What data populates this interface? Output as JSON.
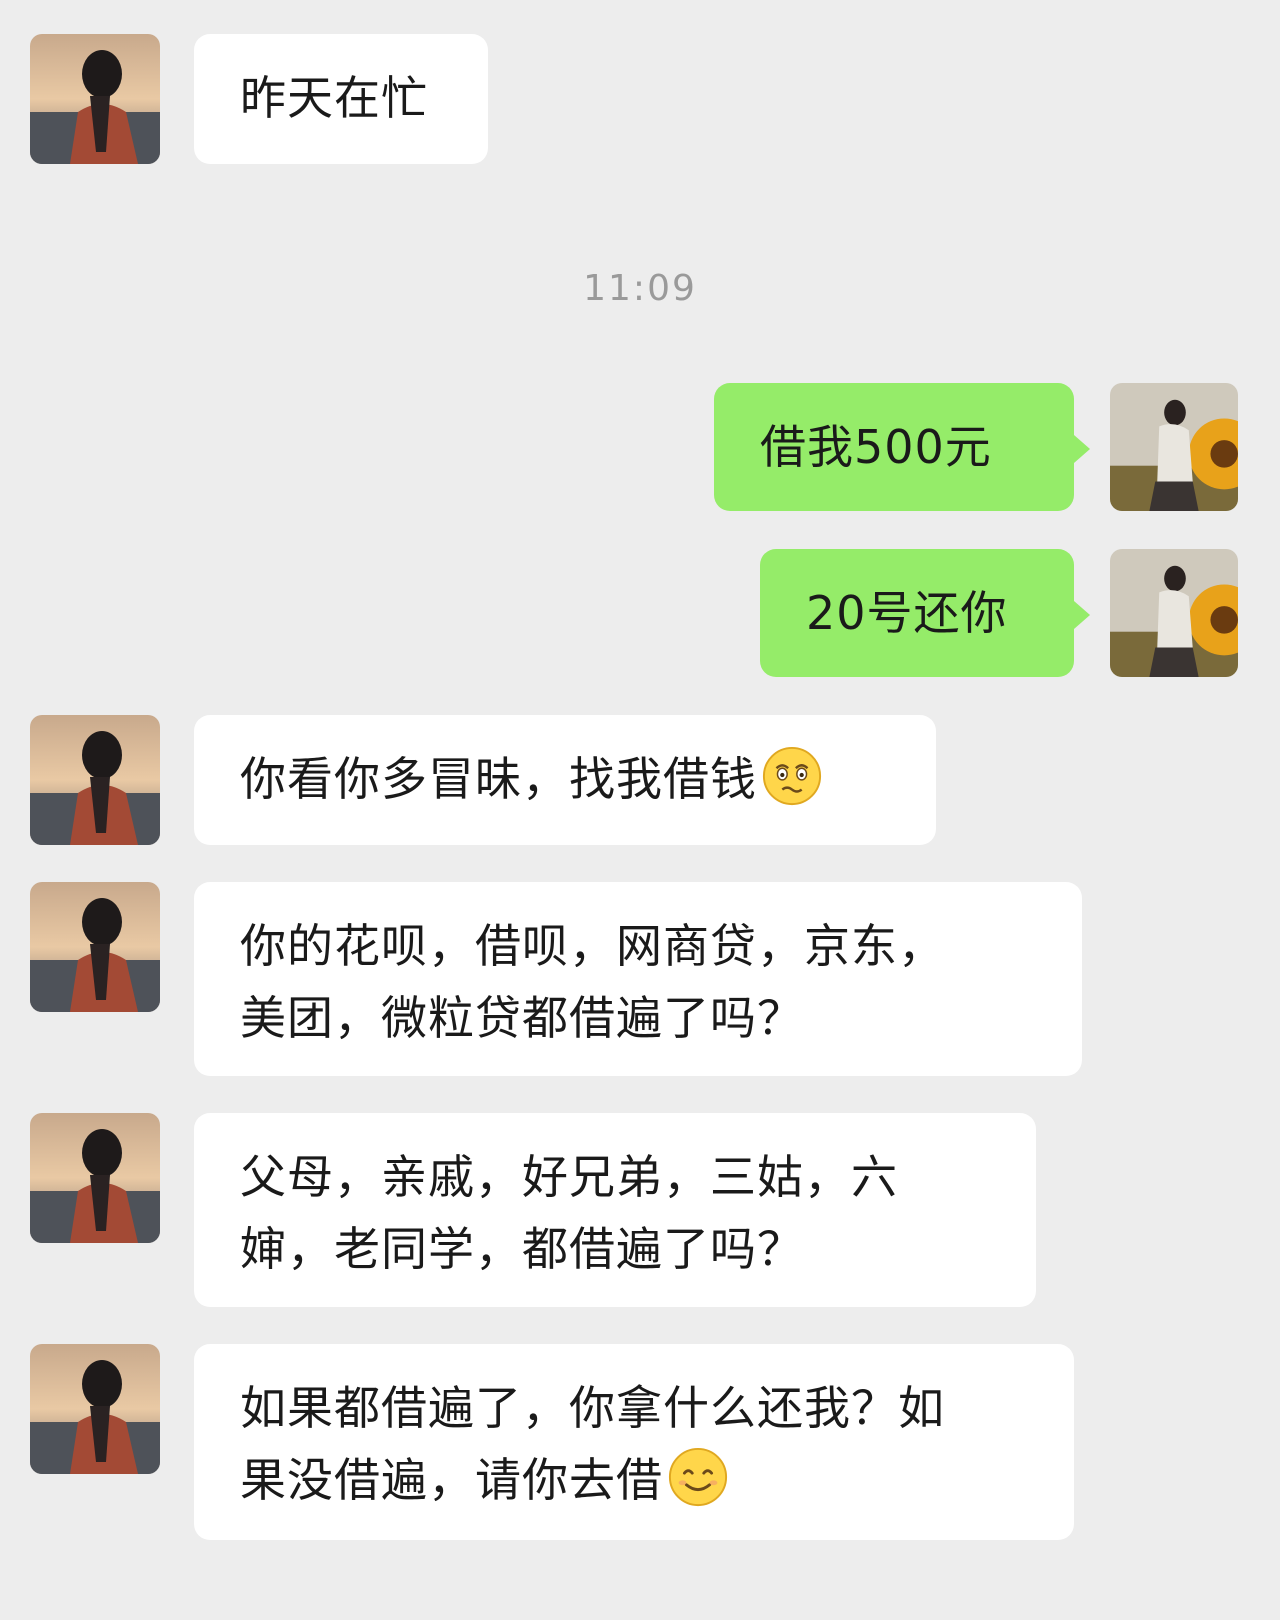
{
  "chat": {
    "timestamp": "11:09",
    "messages": [
      {
        "side": "left",
        "text": "昨天在忙"
      },
      {
        "side": "right",
        "text": "借我500元"
      },
      {
        "side": "right",
        "text": "20号还你"
      },
      {
        "side": "left",
        "text": "你看你多冒昧，找我借钱",
        "emoji": "awkward-face-emoji"
      },
      {
        "side": "left",
        "line1": "你的花呗，借呗，网商贷，京东，",
        "line2": "美团，微粒贷都借遍了吗？"
      },
      {
        "side": "left",
        "line1": "父母，亲戚，好兄弟，三姑，六",
        "line2": "婶，老同学，都借遍了吗？"
      },
      {
        "side": "left",
        "line1": "如果都借遍了，你拿什么还我？如",
        "line2": "果没借遍，请你去借",
        "emoji": "smile-face-emoji"
      }
    ]
  },
  "colors": {
    "background": "#ededed",
    "incoming_bubble": "#ffffff",
    "outgoing_bubble": "#95ec69",
    "timestamp_text": "#9a9a9a"
  }
}
